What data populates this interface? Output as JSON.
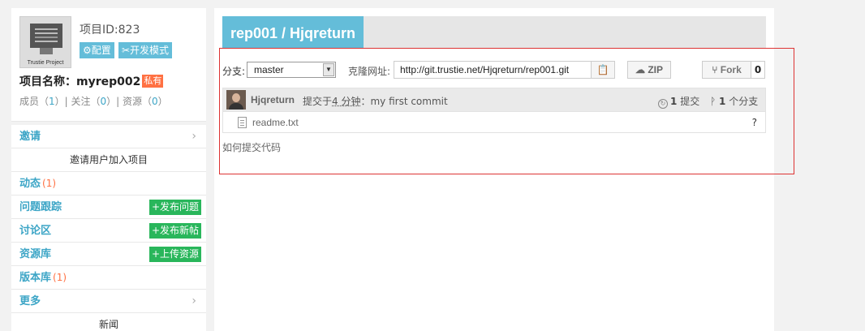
{
  "project": {
    "id_label": "项目ID:823",
    "config_btn": "⚙配置",
    "dev_btn": "✂开发模式",
    "name_label": "项目名称：",
    "name": "myrep002",
    "private_badge": "私有",
    "stats": {
      "members_label": "成员（",
      "members": "1",
      "follows_label": "）| 关注（",
      "follows": "0",
      "resources_label": "）| 资源（",
      "resources": "0",
      "end": "）"
    },
    "logo_caption": "Trustie Project"
  },
  "menu": {
    "invite": "邀请",
    "invite_sub": "邀请用户加入项目",
    "activity": "动态",
    "activity_count": "(1)",
    "issues": "问题跟踪",
    "issues_action": "+发布问题",
    "forum": "讨论区",
    "forum_action": "+发布新帖",
    "resources": "资源库",
    "resources_action": "+上传资源",
    "repo": "版本库",
    "repo_count": "(1)",
    "more": "更多",
    "news": "新闻"
  },
  "repo": {
    "title": "rep001 / Hjqreturn",
    "branch_label": "分支:",
    "branch_value": "master",
    "clone_label": "克隆网址:",
    "clone_url": "http://git.trustie.net/Hjqreturn/rep001.git",
    "zip_label": "ZIP",
    "fork_label": "Fork",
    "fork_count": "0"
  },
  "commit": {
    "author": "Hjqreturn",
    "pre": "提交于",
    "time": "4 分钟",
    "msg": "：my first commit",
    "commits_num": "1",
    "commits_label": "提交",
    "branches_num": "1",
    "branches_label": "个分支"
  },
  "files": [
    {
      "name": "readme.txt",
      "meta": "?"
    }
  ],
  "how_to": "如何提交代码"
}
